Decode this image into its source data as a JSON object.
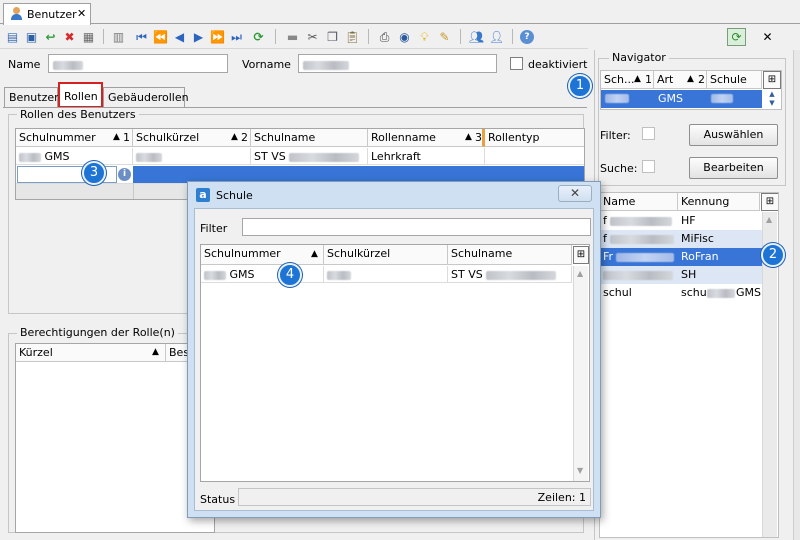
{
  "tab": {
    "label": "Benutzer",
    "close": "✕"
  },
  "form": {
    "name_label": "Name",
    "vorname_label": "Vorname",
    "deaktiviert_label": "deaktiviert"
  },
  "subtabs": [
    "Benutzer",
    "Rollen",
    "Gebäuderollen"
  ],
  "rollen_group": {
    "title": "Rollen des Benutzers",
    "columns": [
      "Schulnummer",
      "Schulkürzel",
      "Schulname",
      "Rollenname",
      "Rollentyp"
    ],
    "sort_marks": [
      "1",
      "2",
      "",
      "3",
      ""
    ],
    "row": {
      "schulnummer_suffix": "GMS",
      "schulname_prefix": "ST VS",
      "rollenname": "Lehrkraft"
    }
  },
  "berechtigungen_group": {
    "title": "Berechtigungen der Rolle(n)",
    "columns": [
      "Kürzel",
      "Bes"
    ]
  },
  "navigator": {
    "title": "Navigator",
    "columns": [
      "Sch...",
      "Art",
      "Schule"
    ],
    "sort_marks": [
      "1",
      "2",
      ""
    ],
    "selected_art": "GMS",
    "filter_label": "Filter:",
    "suche_label": "Suche:",
    "auswaehlen": "Auswählen",
    "bearbeiten": "Bearbeiten",
    "list_columns": [
      "Name",
      "Kennung"
    ],
    "list_rows": [
      {
        "name_prefix": "f",
        "kennung": "HF"
      },
      {
        "name_prefix": "f",
        "kennung": "MiFisc"
      },
      {
        "name_prefix": "Fr",
        "kennung": "RoFran"
      },
      {
        "name_prefix": "",
        "kennung": "SH"
      },
      {
        "name_prefix": "schul",
        "kennung_prefix": "schu",
        "kennung": "GMS"
      }
    ]
  },
  "dialog": {
    "logo": "a",
    "title": "Schule",
    "close": "✕",
    "filter_label": "Filter",
    "columns": [
      "Schulnummer",
      "Schulkürzel",
      "Schulname"
    ],
    "row": {
      "schulnummer_suffix": "GMS",
      "schulname_prefix": "ST VS"
    },
    "status_label": "Status",
    "zeilen": "Zeilen: 1"
  },
  "callouts": [
    "1",
    "2",
    "3",
    "4"
  ],
  "icons": {
    "colors": {
      "accent": "#1e74d4",
      "selection": "#3875d7",
      "highlight_border": "#d42222"
    }
  }
}
